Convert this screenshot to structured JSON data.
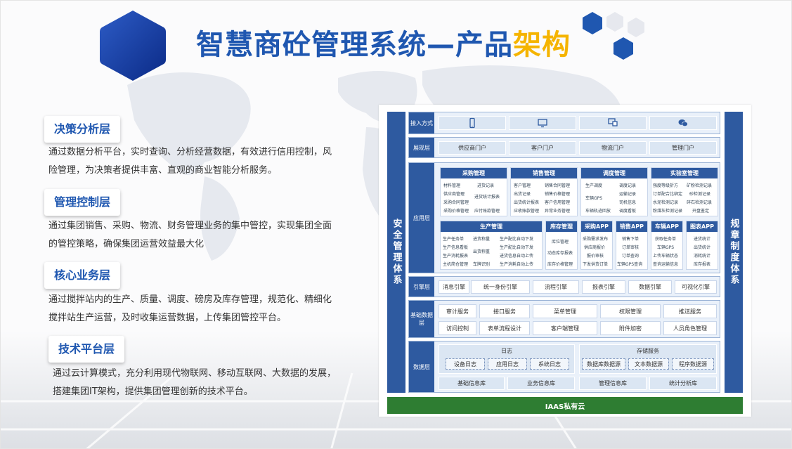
{
  "title": {
    "main": "智慧商砼管理系统—产品",
    "accent": "架构"
  },
  "layers": [
    {
      "label": "决策分析层",
      "desc": "通过数据分析平台，实时查询、分析经营数据，有效进行信用控制，风险管理，为决策者提供丰富、直观的商业智能分析服务。"
    },
    {
      "label": "管理控制层",
      "desc": "通过集团销售、采购、物流、财务管理业务的集中管控，实现集团全面的管控策略，确保集团运营效益最大化"
    },
    {
      "label": "核心业务层",
      "desc": "通过搅拌站内的生产、质量、调度、磅房及库存管理，规范化、精细化搅拌站生产运营，及时收集运营数据，上传集团管控平台。"
    },
    {
      "label": "技术平台层",
      "desc": "通过云计算模式，充分利用现代物联网、移动互联网、大数据的发展，搭建集团IT架构，提供集团管理创新的技术平台。"
    }
  ],
  "arch": {
    "left_bar": "安全管理体系",
    "right_bar": "规章制度体系",
    "access": {
      "label": "接入方式",
      "icons": [
        "phone-icon",
        "monitor-icon",
        "desktop-icon",
        "wechat-icon"
      ]
    },
    "display": {
      "label": "展现层",
      "items": [
        "供应商门户",
        "客户门户",
        "物流门户",
        "管理门户"
      ]
    },
    "app": {
      "label": "应用层",
      "modules_top": [
        {
          "name": "采购管理",
          "items": [
            "材料管理",
            "进货记录",
            "供应商管理",
            "进货统计报表",
            "采购合同管理",
            "采购价格管理",
            "应付账款管理"
          ]
        },
        {
          "name": "销售管理",
          "items": [
            "客户管理",
            "销售合同管理",
            "出货记录",
            "销售价格管理",
            "出货统计报表",
            "客户信用管理",
            "应收账款管理",
            "异常业务管理"
          ]
        },
        {
          "name": "调度管理",
          "items": [
            "生产调度",
            "调度记录",
            "运输记录",
            "车辆GPS",
            "司机信息",
            "车辆轨迹回放",
            "调度看板"
          ]
        },
        {
          "name": "实验室管理",
          "items": [
            "强度等级折方",
            "矿粉检测记录",
            "订单配合比绑定",
            "砂检测记录",
            "水泥检测记录",
            "碎石检测记录",
            "粉煤灰检测记录",
            "开盘鉴定"
          ]
        }
      ],
      "modules_bottom": [
        {
          "name": "生产管理",
          "items": [
            "生产任务单",
            "进货称量",
            "生产配比自动下发",
            "生产信息看板",
            "出货称重",
            "生产配比自动下发",
            "生产消耗报表",
            "进货信息自动上传",
            "主机简仓管理",
            "车牌识别",
            "生产消耗自动上传"
          ]
        },
        {
          "name": "库存管理",
          "items": [
            "库位管理",
            "动态库存报表",
            "库存价格管理"
          ]
        },
        {
          "name": "采购APP",
          "items": [
            "采购需求发布",
            "供应商报价",
            "报价审核",
            "下发供货订单"
          ]
        },
        {
          "name": "销售APP",
          "items": [
            "销售下单",
            "订单审核",
            "订单查询",
            "车辆GPS查询"
          ]
        },
        {
          "name": "车辆APP",
          "items": [
            "获取任务单",
            "车辆GPS",
            "上传车辆状态",
            "查询运输信息"
          ]
        },
        {
          "name": "图表APP",
          "items": [
            "进货统计",
            "出货统计",
            "消耗统计",
            "库存报表"
          ]
        }
      ]
    },
    "engine": {
      "label": "引擎层",
      "items": [
        "消息引擎",
        "统一身份引擎",
        "流程引擎",
        "报表引擎",
        "数据引擎",
        "可视化引擎"
      ]
    },
    "base": {
      "label": "基础数据层",
      "items": [
        "审计服务",
        "接口服务",
        "菜单管理",
        "权限管理",
        "推送服务",
        "访问控制",
        "表单流程设计",
        "客户端管理",
        "附件加密",
        "人员角色管理"
      ]
    },
    "data": {
      "label": "数据层",
      "log_title": "日志",
      "logs": [
        "设备日志",
        "应用日志",
        "系统日志"
      ],
      "storage_title": "存储服务",
      "storage": [
        "数据库数据源",
        "文本数据源",
        "程序数据源"
      ],
      "dbs": [
        "基础信息库",
        "业务信息库",
        "管理信息库",
        "统计分析库"
      ]
    },
    "iaas": "IAAS私有云"
  }
}
